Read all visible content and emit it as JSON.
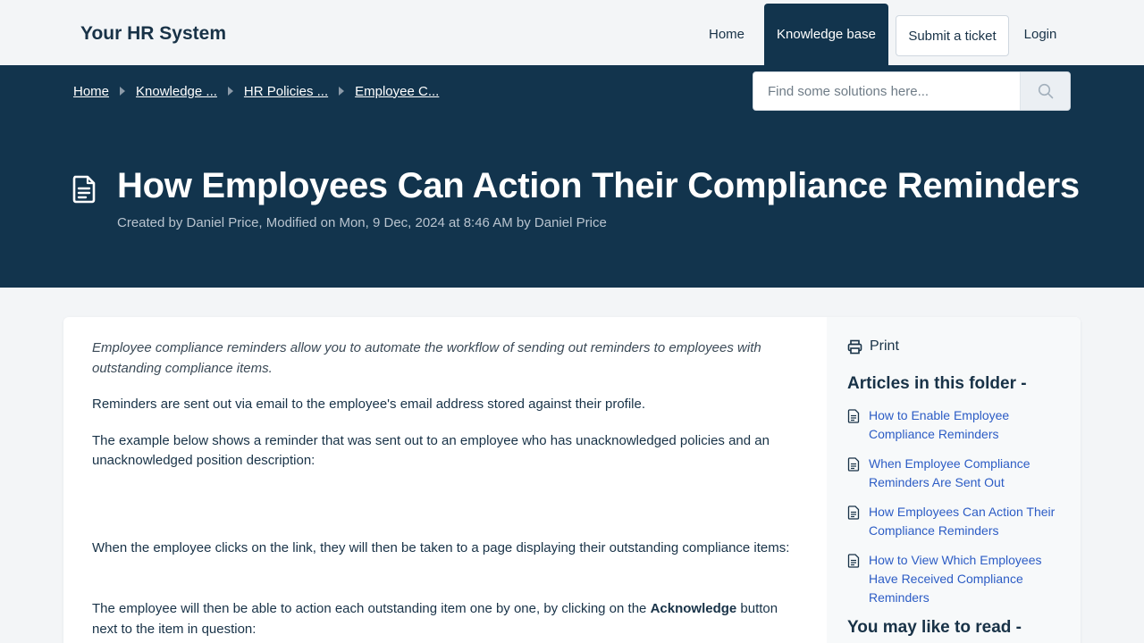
{
  "header": {
    "brand": "Your HR System",
    "nav": {
      "home": "Home",
      "knowledge_base": "Knowledge base",
      "submit_ticket": "Submit a ticket",
      "login": "Login"
    }
  },
  "breadcrumb": [
    "Home",
    "Knowledge ...",
    "HR Policies ...",
    "Employee C..."
  ],
  "search": {
    "placeholder": "Find some solutions here..."
  },
  "article": {
    "title": "How Employees Can Action Their Compliance Reminders",
    "meta": "Created by Daniel Price, Modified on Mon, 9 Dec, 2024 at 8:46 AM by Daniel Price",
    "paragraphs": {
      "intro": "Employee compliance reminders allow you to automate the workflow of sending out reminders to employees with outstanding compliance items.",
      "p1": "Reminders are sent out via email to the employee's email address stored against their profile.",
      "p2": "The example below shows a reminder that was sent out to an employee who has unacknowledged policies and an unacknowledged position description:",
      "p3": "When the employee clicks on the link, they will then be taken to a page displaying their outstanding compliance items:",
      "p4_before": "The employee will then be able to action each outstanding item one by one, by clicking on the ",
      "p4_bold": "Acknowledge",
      "p4_after": " button next to the item in question:"
    }
  },
  "sidebar": {
    "print_label": "Print",
    "folder_heading": "Articles in this folder -",
    "folder_articles": [
      "How to Enable Employee Compliance Reminders",
      "When Employee Compliance Reminders Are Sent Out",
      "How Employees Can Action Their Compliance Reminders",
      "How to View Which Employees Have Received Compliance Reminders"
    ],
    "related_heading": "You may like to read -"
  },
  "icons": {
    "search": "search-icon",
    "article": "document-icon",
    "print": "printer-icon"
  },
  "colors": {
    "brand_dark": "#12344d",
    "link": "#2c5cc5",
    "page_bg": "#f3f5f7"
  }
}
